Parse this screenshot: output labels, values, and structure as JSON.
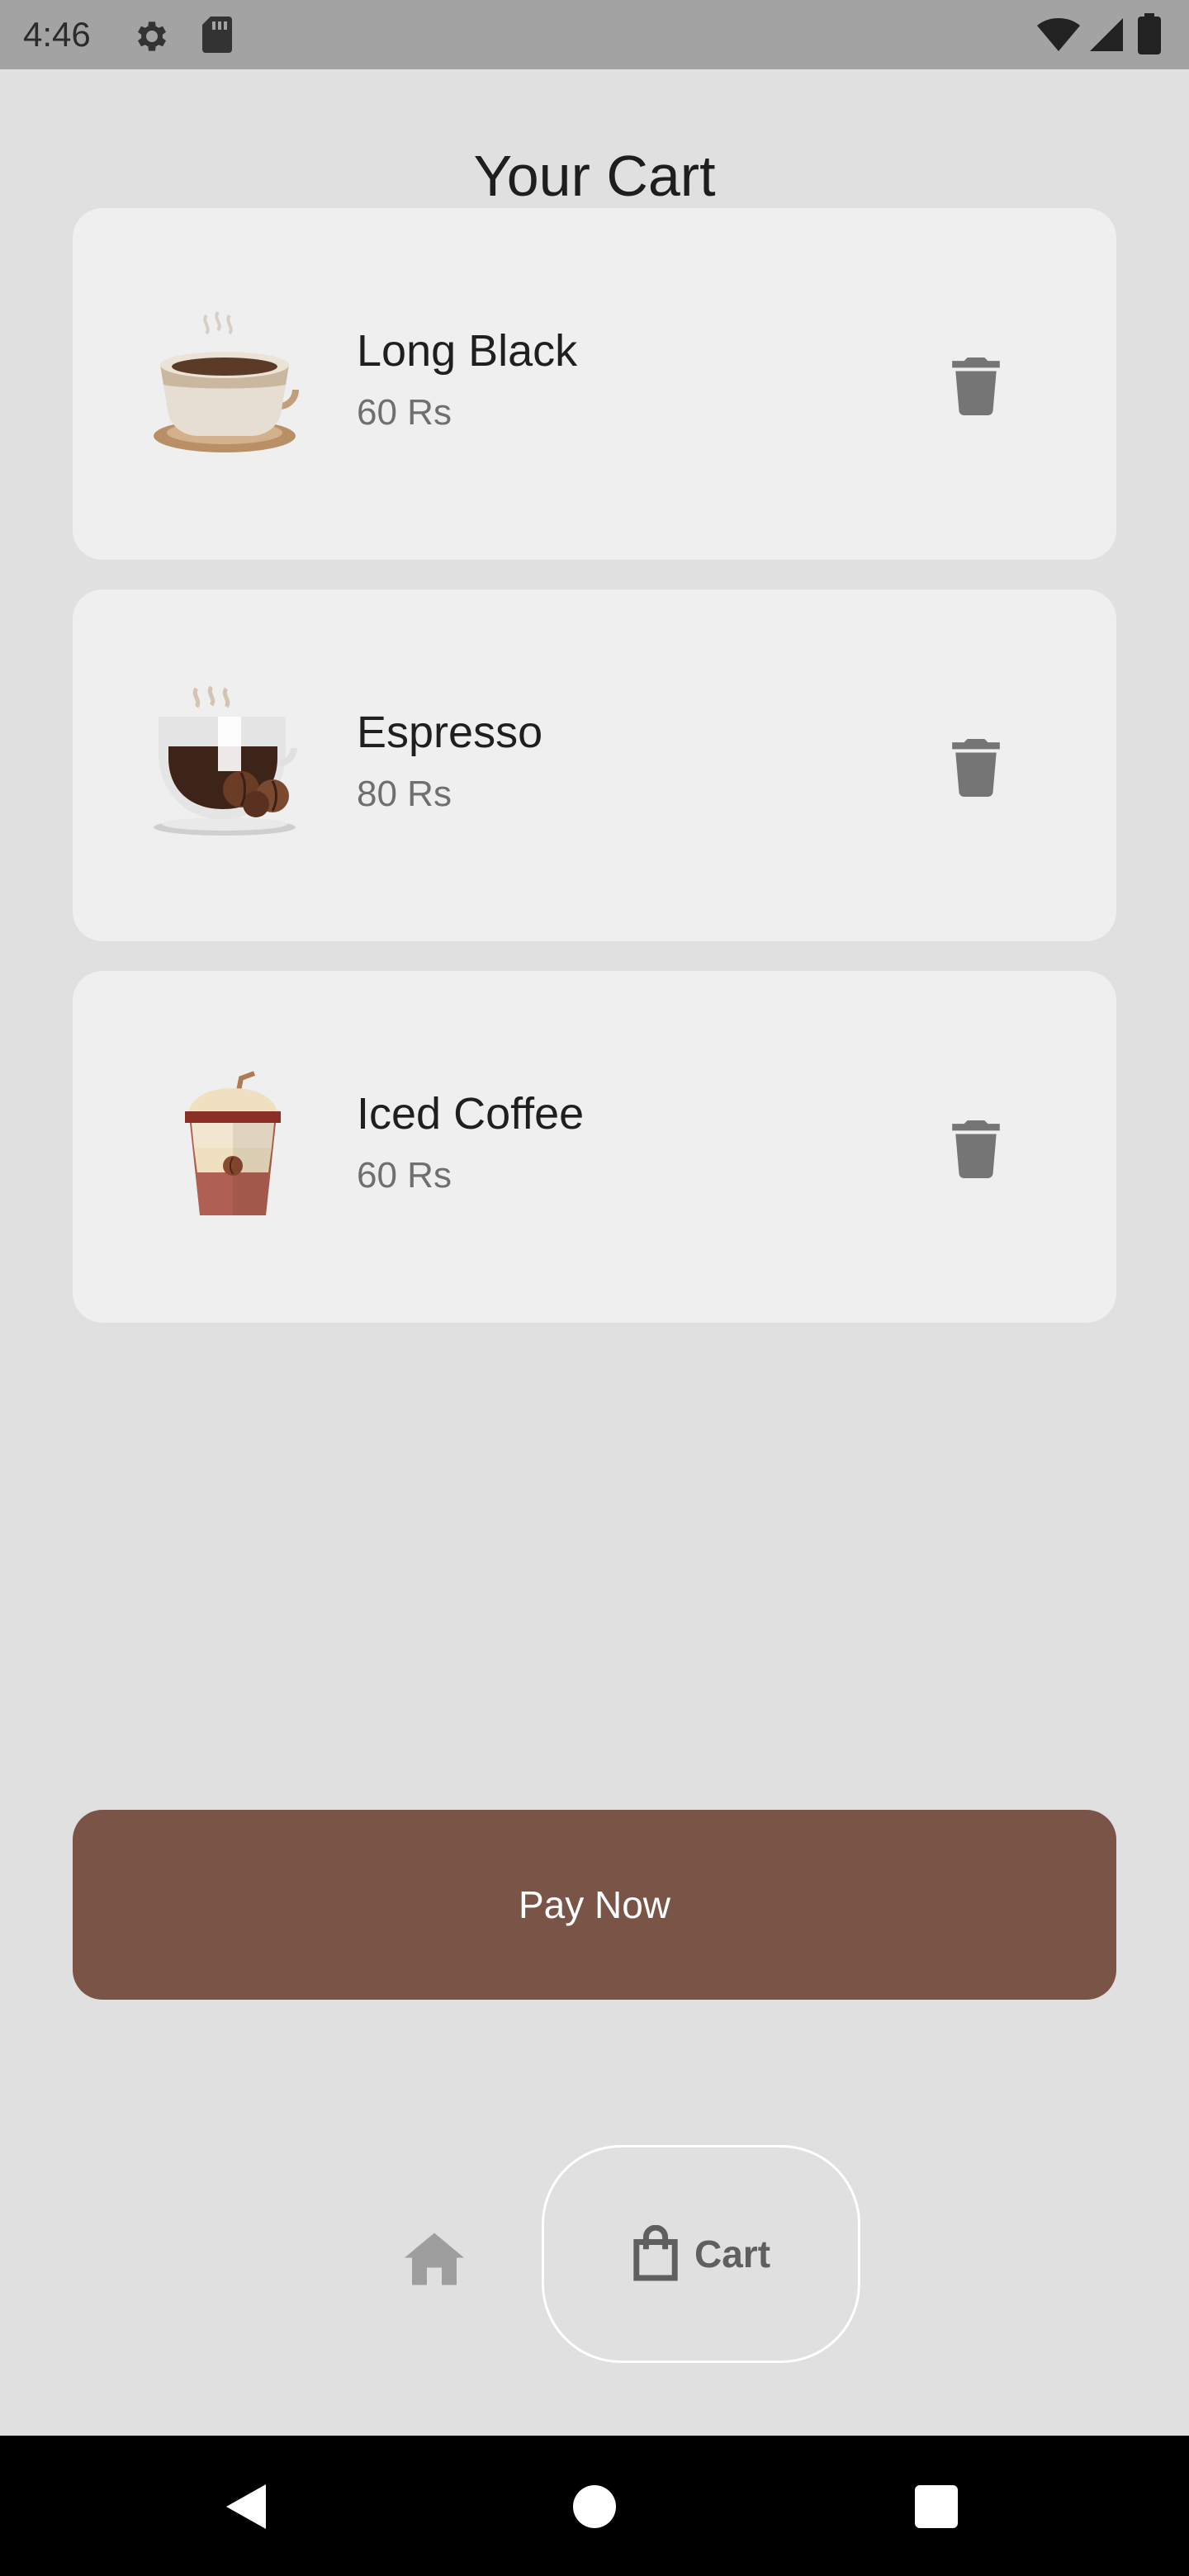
{
  "status_bar": {
    "time": "4:46",
    "icons": [
      "gear-icon",
      "sd-card-icon",
      "wifi-icon",
      "signal-icon",
      "battery-icon"
    ]
  },
  "page": {
    "title": "Your Cart"
  },
  "cart": {
    "items": [
      {
        "name": "Long Black",
        "price": "60 Rs",
        "image_icon": "hot-coffee-cup-icon",
        "action_icon": "trash-icon"
      },
      {
        "name": "Espresso",
        "price": "80 Rs",
        "image_icon": "espresso-cup-icon",
        "action_icon": "trash-icon"
      },
      {
        "name": "Iced Coffee",
        "price": "60 Rs",
        "image_icon": "iced-coffee-icon",
        "action_icon": "trash-icon"
      }
    ]
  },
  "checkout": {
    "pay_label": "Pay Now"
  },
  "bottom_nav": {
    "home_icon": "home-icon",
    "cart_icon": "shopping-bag-icon",
    "cart_label": "Cart",
    "active_tab": "Cart"
  },
  "system_nav": {
    "buttons": [
      "back",
      "home",
      "recents"
    ]
  },
  "colors": {
    "background": "#e0e0e0",
    "card": "#efefef",
    "accent": "#7a5446",
    "status_bar": "#a3a3a3",
    "muted_text": "#6f6f6f",
    "icon_gray": "#757575"
  }
}
